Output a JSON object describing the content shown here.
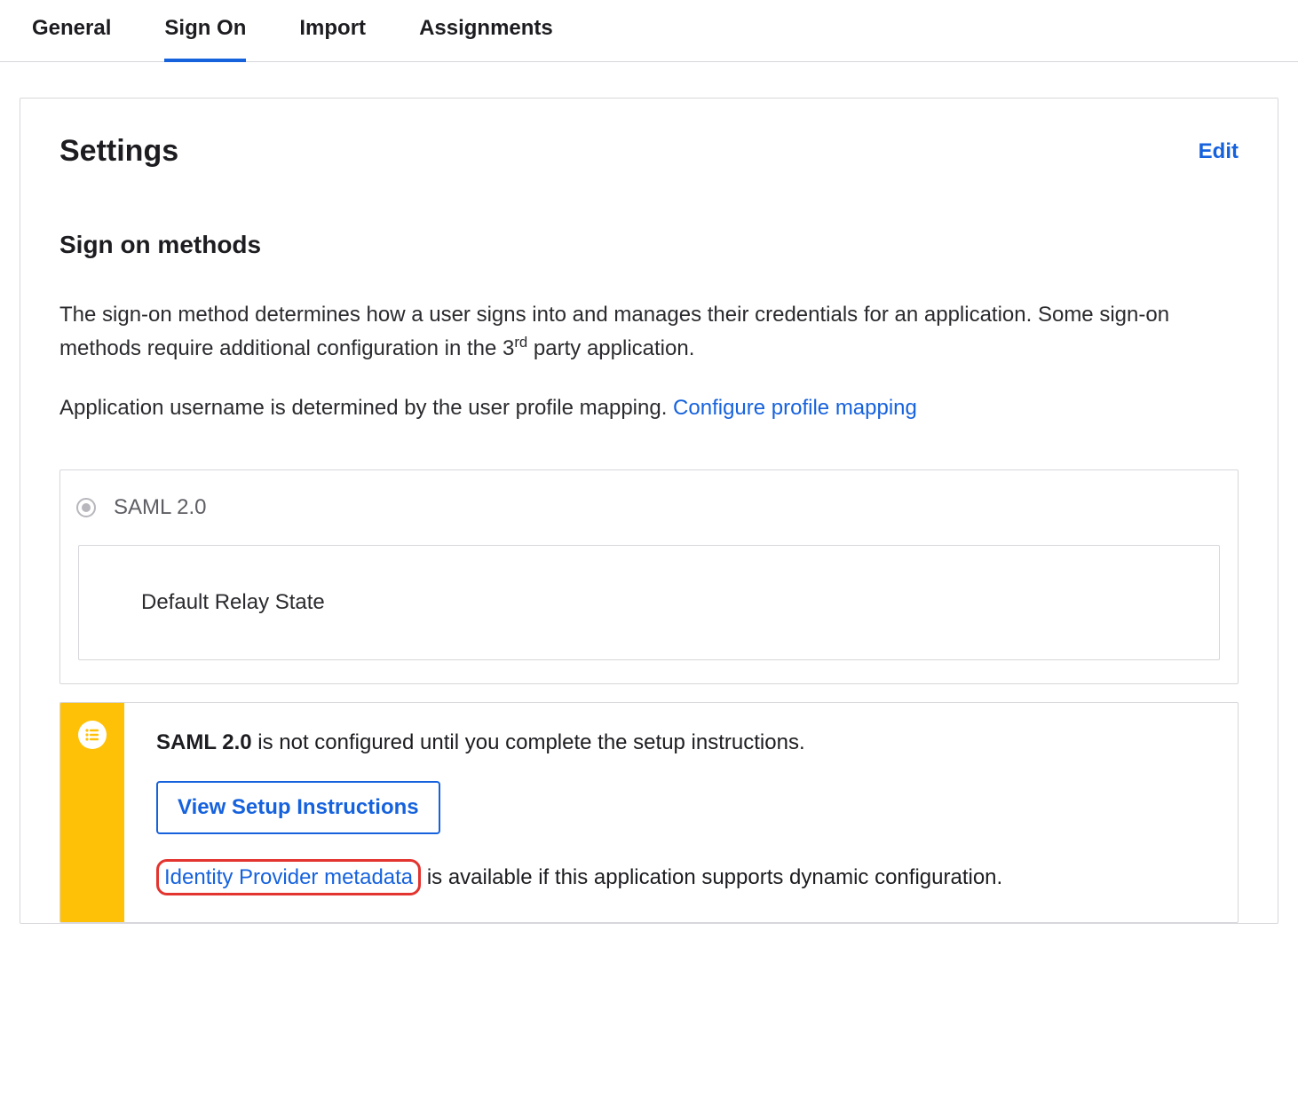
{
  "tabs": {
    "general": "General",
    "sign_on": "Sign On",
    "import": "Import",
    "assignments": "Assignments"
  },
  "panel": {
    "title": "Settings",
    "edit": "Edit"
  },
  "section": {
    "heading": "Sign on methods",
    "desc_part1": "The sign-on method determines how a user signs into and manages their credentials for an application. Some sign-on methods require additional configuration in the 3",
    "desc_sup": "rd",
    "desc_part2": " party application.",
    "desc2_prefix": "Application username is determined by the user profile mapping. ",
    "profile_link": "Configure profile mapping"
  },
  "radio": {
    "label": "SAML 2.0",
    "relay_label": "Default Relay State"
  },
  "alert": {
    "strong": "SAML 2.0",
    "line1_rest": " is not configured until you complete the setup instructions.",
    "button": "View Setup Instructions",
    "meta_link": "Identity Provider metadata",
    "line2_rest": " is available if this application supports dynamic configuration."
  }
}
